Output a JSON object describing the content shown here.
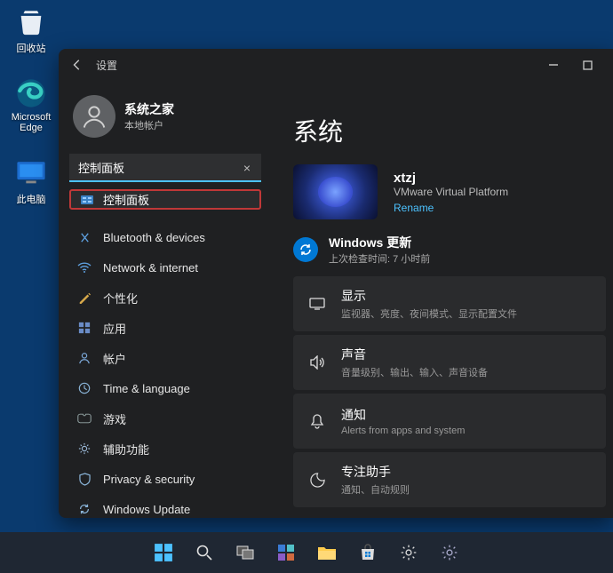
{
  "desktop": {
    "recycle": "回收站",
    "edge": "Microsoft Edge",
    "thispc": "此电脑"
  },
  "window": {
    "title": "设置",
    "user": {
      "name": "系统之家",
      "sub": "本地帐户"
    },
    "search": {
      "value": "控制面板",
      "clear_tip": "×"
    },
    "suggest": "控制面板",
    "nav": [
      "Bluetooth & devices",
      "Network & internet",
      "个性化",
      "应用",
      "帐户",
      "Time & language",
      "游戏",
      "辅助功能",
      "Privacy & security",
      "Windows Update"
    ]
  },
  "main": {
    "heading": "系统",
    "pc": {
      "name": "xtzj",
      "platform": "VMware Virtual Platform",
      "rename": "Rename"
    },
    "wu": {
      "title": "Windows 更新",
      "sub": "上次检查时间: 7 小时前"
    },
    "cards": [
      {
        "t": "显示",
        "s": "监视器、亮度、夜间模式、显示配置文件"
      },
      {
        "t": "声音",
        "s": "音量级别、输出、输入、声音设备"
      },
      {
        "t": "通知",
        "s": "Alerts from apps and system"
      },
      {
        "t": "专注助手",
        "s": "通知、自动规则"
      }
    ]
  }
}
